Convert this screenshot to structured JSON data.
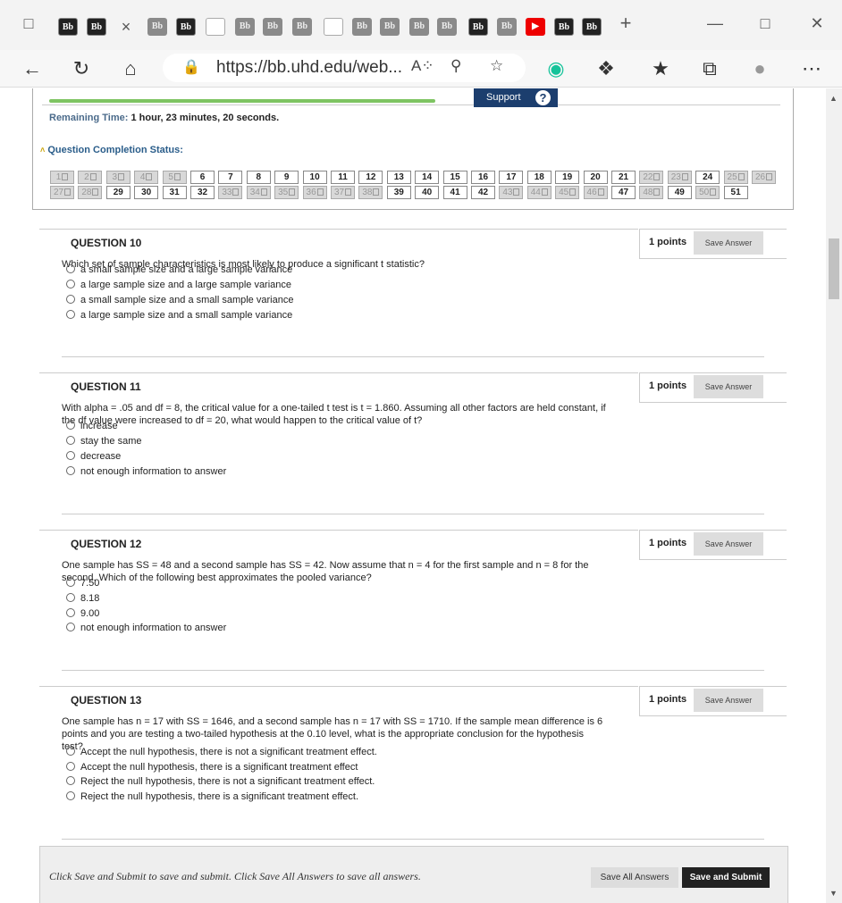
{
  "browser": {
    "url": "https://bb.uhd.edu/web...",
    "new_tab": "+",
    "tabs": [
      {
        "label": "Bb",
        "style": "bb"
      },
      {
        "label": "Bb",
        "style": "bb"
      },
      {
        "label": "×",
        "style": "close"
      },
      {
        "label": "Bb",
        "style": "bbl"
      },
      {
        "label": "Bb",
        "style": "bb"
      },
      {
        "label": "",
        "style": "doc"
      },
      {
        "label": "Bb",
        "style": "bbl"
      },
      {
        "label": "Bb",
        "style": "bbl"
      },
      {
        "label": "Bb",
        "style": "bbl"
      },
      {
        "label": "",
        "style": "doc"
      },
      {
        "label": "Bb",
        "style": "bbl"
      },
      {
        "label": "Bb",
        "style": "bbl"
      },
      {
        "label": "Bb",
        "style": "bbl"
      },
      {
        "label": "Bb",
        "style": "bbl"
      },
      {
        "label": "Bb",
        "style": "bb"
      },
      {
        "label": "Bb",
        "style": "bbl"
      },
      {
        "label": "▶",
        "style": "yt"
      },
      {
        "label": "Bb",
        "style": "bb"
      },
      {
        "label": "Bb",
        "style": "bb"
      }
    ]
  },
  "status": {
    "support_label": "Support",
    "support_icon": "?",
    "remaining_label": "Remaining Time:",
    "remaining_value": "1 hour, 23 minutes, 20 seconds.",
    "completion_label": "Question Completion Status:",
    "progress_fraction": 0.51,
    "row1": [
      {
        "n": "1",
        "saved": true
      },
      {
        "n": "2",
        "saved": true
      },
      {
        "n": "3",
        "saved": true
      },
      {
        "n": "4",
        "saved": true
      },
      {
        "n": "5",
        "saved": true
      },
      {
        "n": "6",
        "saved": false
      },
      {
        "n": "7",
        "saved": false
      },
      {
        "n": "8",
        "saved": false
      },
      {
        "n": "9",
        "saved": false
      },
      {
        "n": "10",
        "saved": false
      },
      {
        "n": "11",
        "saved": false
      },
      {
        "n": "12",
        "saved": false
      },
      {
        "n": "13",
        "saved": false
      },
      {
        "n": "14",
        "saved": false
      },
      {
        "n": "15",
        "saved": false
      },
      {
        "n": "16",
        "saved": false
      },
      {
        "n": "17",
        "saved": false
      },
      {
        "n": "18",
        "saved": false
      },
      {
        "n": "19",
        "saved": false
      },
      {
        "n": "20",
        "saved": false
      },
      {
        "n": "21",
        "saved": false
      },
      {
        "n": "22",
        "saved": true
      },
      {
        "n": "23",
        "saved": true
      },
      {
        "n": "24",
        "saved": false
      },
      {
        "n": "25",
        "saved": true
      },
      {
        "n": "26",
        "saved": true
      }
    ],
    "row2": [
      {
        "n": "27",
        "saved": true
      },
      {
        "n": "28",
        "saved": true
      },
      {
        "n": "29",
        "saved": false
      },
      {
        "n": "30",
        "saved": false
      },
      {
        "n": "31",
        "saved": false
      },
      {
        "n": "32",
        "saved": false
      },
      {
        "n": "33",
        "saved": true
      },
      {
        "n": "34",
        "saved": true
      },
      {
        "n": "35",
        "saved": true
      },
      {
        "n": "36",
        "saved": true
      },
      {
        "n": "37",
        "saved": true
      },
      {
        "n": "38",
        "saved": true
      },
      {
        "n": "39",
        "saved": false
      },
      {
        "n": "40",
        "saved": false
      },
      {
        "n": "41",
        "saved": false
      },
      {
        "n": "42",
        "saved": false
      },
      {
        "n": "43",
        "saved": true
      },
      {
        "n": "44",
        "saved": true
      },
      {
        "n": "45",
        "saved": true
      },
      {
        "n": "46",
        "saved": true
      },
      {
        "n": "47",
        "saved": false
      },
      {
        "n": "48",
        "saved": true
      },
      {
        "n": "49",
        "saved": false
      },
      {
        "n": "50",
        "saved": true
      },
      {
        "n": "51",
        "saved": false
      }
    ]
  },
  "questions": [
    {
      "title": "QUESTION 10",
      "points": "1 points",
      "save": "Save Answer",
      "text": "Which set of sample characteristics is most likely to produce a significant t statistic?",
      "options": [
        "a small sample size and a large sample variance",
        "a large sample size and a large sample variance",
        "a small sample size and a small sample variance",
        "a large sample size and a small sample variance"
      ]
    },
    {
      "title": "QUESTION 11",
      "points": "1 points",
      "save": "Save Answer",
      "text": "With alpha = .05 and df = 8, the critical value for a one-tailed t test is t = 1.860. Assuming all other factors are held constant, if the df value were increased to df = 20, what would happen to the critical value of t?",
      "options": [
        "increase",
        "stay the same",
        "decrease",
        "not enough information to answer"
      ]
    },
    {
      "title": "QUESTION 12",
      "points": "1 points",
      "save": "Save Answer",
      "text": "One sample has SS = 48 and a second sample has SS = 42. Now assume that n = 4 for the first sample and n = 8 for the second. Which of the following best approximates the pooled variance?",
      "options": [
        "7.50",
        "8.18",
        "9.00",
        "not enough information to answer"
      ]
    },
    {
      "title": "QUESTION 13",
      "points": "1 points",
      "save": "Save Answer",
      "text": "One sample has n = 17 with SS = 1646, and a second sample has n = 17 with SS = 1710. If the sample mean difference is 6 points and you are testing a two-tailed hypothesis at the 0.10 level, what is the appropriate conclusion for the hypothesis test?",
      "options": [
        "Accept the null hypothesis, there is not a significant treatment effect.",
        "Accept the null hypothesis, there is a significant treatment effect",
        "Reject the null hypothesis, there is not a significant treatment effect.",
        "Reject the null hypothesis, there is a significant treatment effect."
      ]
    }
  ],
  "footer": {
    "text": "Click Save and Submit to save and submit. Click Save All Answers to save all answers.",
    "save_all": "Save All Answers",
    "save_submit": "Save and Submit"
  },
  "icons": {
    "back": "back-arrow-icon",
    "refresh": "refresh-icon",
    "home": "home-icon",
    "lock": "lock-icon",
    "read_aloud": "read-aloud-icon",
    "zoom": "zoom-icon",
    "favorite": "favorite-add-icon",
    "grammarly": "grammarly-icon",
    "extensions": "extensions-icon",
    "favorites": "favorites-icon",
    "collections": "collections-icon",
    "profile": "profile-icon",
    "more": "more-icon"
  }
}
